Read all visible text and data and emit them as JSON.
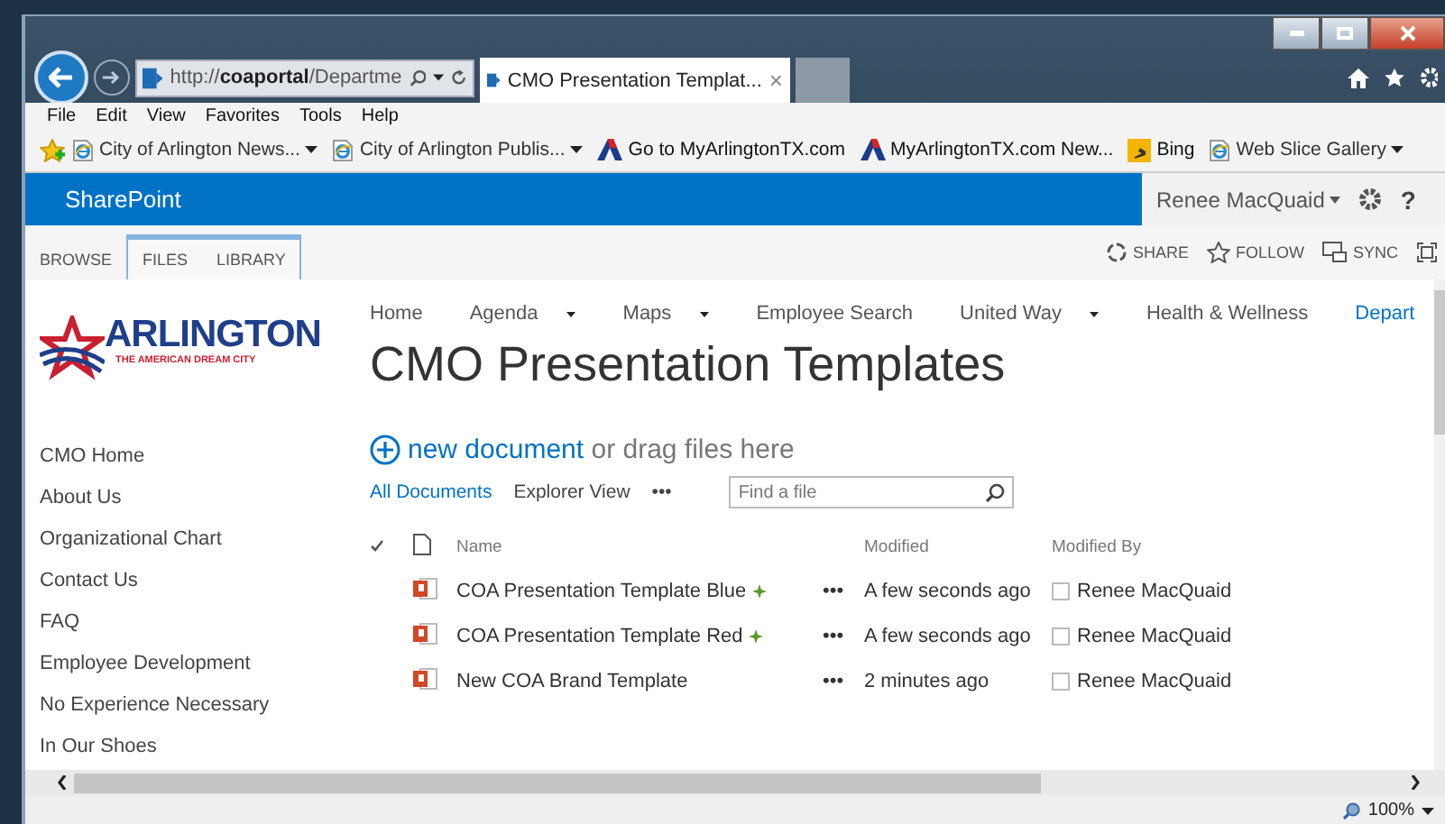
{
  "browser": {
    "address": "http://**coaportal**/Departme",
    "tab": {
      "title": "CMO Presentation Templat...",
      "close": "×"
    }
  },
  "menu": [
    "File",
    "Edit",
    "View",
    "Favorites",
    "Tools",
    "Help"
  ],
  "favorites": [
    {
      "label": "City of Arlington News...",
      "kind": "ie",
      "dropdown": true
    },
    {
      "label": "City of Arlington Publis...",
      "kind": "ie",
      "dropdown": true
    },
    {
      "label": "Go to MyArlingtonTX.com",
      "kind": "arlington",
      "dropdown": false
    },
    {
      "label": "MyArlingtonTX.com  New...",
      "kind": "arlington",
      "dropdown": false
    },
    {
      "label": "Bing",
      "kind": "bing",
      "dropdown": false
    },
    {
      "label": "Web Slice Gallery",
      "kind": "ie",
      "dropdown": true
    }
  ],
  "suite_bar": {
    "brand": "SharePoint",
    "user": "Renee MacQuaid",
    "help": "?"
  },
  "ribbon": {
    "tabs": [
      {
        "label": "BROWSE",
        "contextual": false
      },
      {
        "label": "FILES",
        "contextual": true
      },
      {
        "label": "LIBRARY",
        "contextual": true
      }
    ],
    "actions": [
      {
        "label": "SHARE",
        "kind": "share"
      },
      {
        "label": "FOLLOW",
        "kind": "follow"
      },
      {
        "label": "SYNC",
        "kind": "sync"
      }
    ]
  },
  "logo": {
    "name": "ARLINGTON",
    "tagline": "THE AMERICAN DREAM CITY"
  },
  "top_nav": [
    {
      "label": "Home",
      "dropdown": false,
      "selected": false
    },
    {
      "label": "Agenda",
      "dropdown": true,
      "selected": false
    },
    {
      "label": "Maps",
      "dropdown": true,
      "selected": false
    },
    {
      "label": "Employee Search",
      "dropdown": false,
      "selected": false
    },
    {
      "label": "United Way",
      "dropdown": true,
      "selected": false
    },
    {
      "label": "Health & Wellness",
      "dropdown": false,
      "selected": false
    },
    {
      "label": "Depart",
      "dropdown": false,
      "selected": true
    }
  ],
  "page_title": "CMO Presentation Templates",
  "quick_launch": [
    "CMO Home",
    "About Us",
    "Organizational Chart",
    "Contact Us",
    "FAQ",
    "Employee Development",
    "No Experience Necessary",
    "In Our Shoes"
  ],
  "new_document": {
    "link": "new document",
    "rest": "or drag files here"
  },
  "views": [
    {
      "label": "All Documents",
      "selected": true
    },
    {
      "label": "Explorer View",
      "selected": false
    }
  ],
  "views_more": "•••",
  "search": {
    "placeholder": "Find a file"
  },
  "columns": {
    "name": "Name",
    "modified": "Modified",
    "modified_by": "Modified By"
  },
  "rows": [
    {
      "name": "COA Presentation Template Blue",
      "new": true,
      "menu": "•••",
      "modified": "A few seconds ago",
      "modified_by": "Renee MacQuaid"
    },
    {
      "name": "COA Presentation Template Red",
      "new": true,
      "menu": "•••",
      "modified": "A few seconds ago",
      "modified_by": "Renee MacQuaid"
    },
    {
      "name": "New COA Brand Template",
      "new": false,
      "menu": "•••",
      "modified": "2 minutes ago",
      "modified_by": "Renee MacQuaid"
    }
  ],
  "status_bar": {
    "zoom": "100%"
  }
}
